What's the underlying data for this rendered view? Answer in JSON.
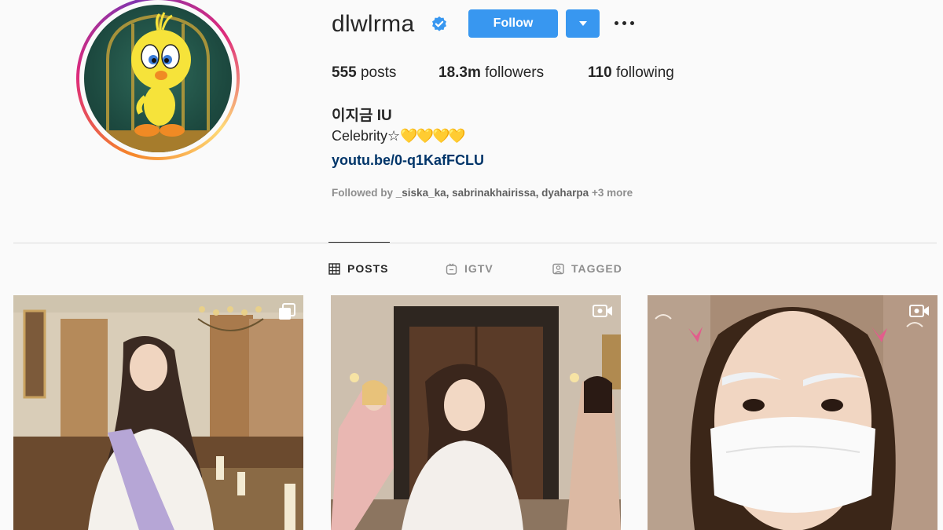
{
  "profile": {
    "username": "dlwlrma",
    "follow_label": "Follow",
    "stats": {
      "posts_count": "555",
      "posts_label": "posts",
      "followers_count": "18.3m",
      "followers_label": "followers",
      "following_count": "110",
      "following_label": "following"
    },
    "full_name": "이지금 IU",
    "bio_text": "Celebrity☆",
    "bio_hearts": "💛💛💛💛",
    "link": "youtu.be/0-q1KafFCLU",
    "followed_by_prefix": "Followed by",
    "followed_by_names": "_siska_ka, sabrinakhairissa, dyaharpa",
    "followed_by_more": "+3 more"
  },
  "tabs": [
    {
      "label": "POSTS",
      "icon": "grid-icon",
      "active": true
    },
    {
      "label": "IGTV",
      "icon": "igtv-icon",
      "active": false
    },
    {
      "label": "TAGGED",
      "icon": "tagged-icon",
      "active": false
    }
  ],
  "posts": [
    {
      "type": "carousel",
      "badge_icon": "multiple-photos-icon"
    },
    {
      "type": "video",
      "badge_icon": "video-icon"
    },
    {
      "type": "video",
      "badge_icon": "video-icon"
    }
  ],
  "colors": {
    "accent": "#3897f0",
    "link": "#003569",
    "muted": "#8e8e8e",
    "verified": "#3897f0"
  }
}
